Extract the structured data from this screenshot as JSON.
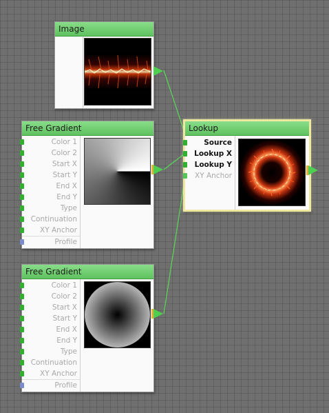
{
  "nodes": {
    "image": {
      "title": "Image"
    },
    "free_gradient_1": {
      "title": "Free Gradient",
      "props": [
        "Color 1",
        "Color 2",
        "Start X",
        "Start Y",
        "End X",
        "End Y",
        "Type",
        "Continuation",
        "XY Anchor",
        "Profile"
      ]
    },
    "free_gradient_2": {
      "title": "Free Gradient",
      "props": [
        "Color 1",
        "Color 2",
        "Start X",
        "Start Y",
        "End X",
        "End Y",
        "Type",
        "Continuation",
        "XY Anchor",
        "Profile"
      ]
    },
    "lookup": {
      "title": "Lookup",
      "props": [
        "Source",
        "Lookup X",
        "Lookup Y",
        "XY Anchor"
      ]
    }
  },
  "colors": {
    "header": "#6fd36f",
    "port": "#30b030",
    "wire": "#5bd35b",
    "selection": "#eee8a0"
  }
}
